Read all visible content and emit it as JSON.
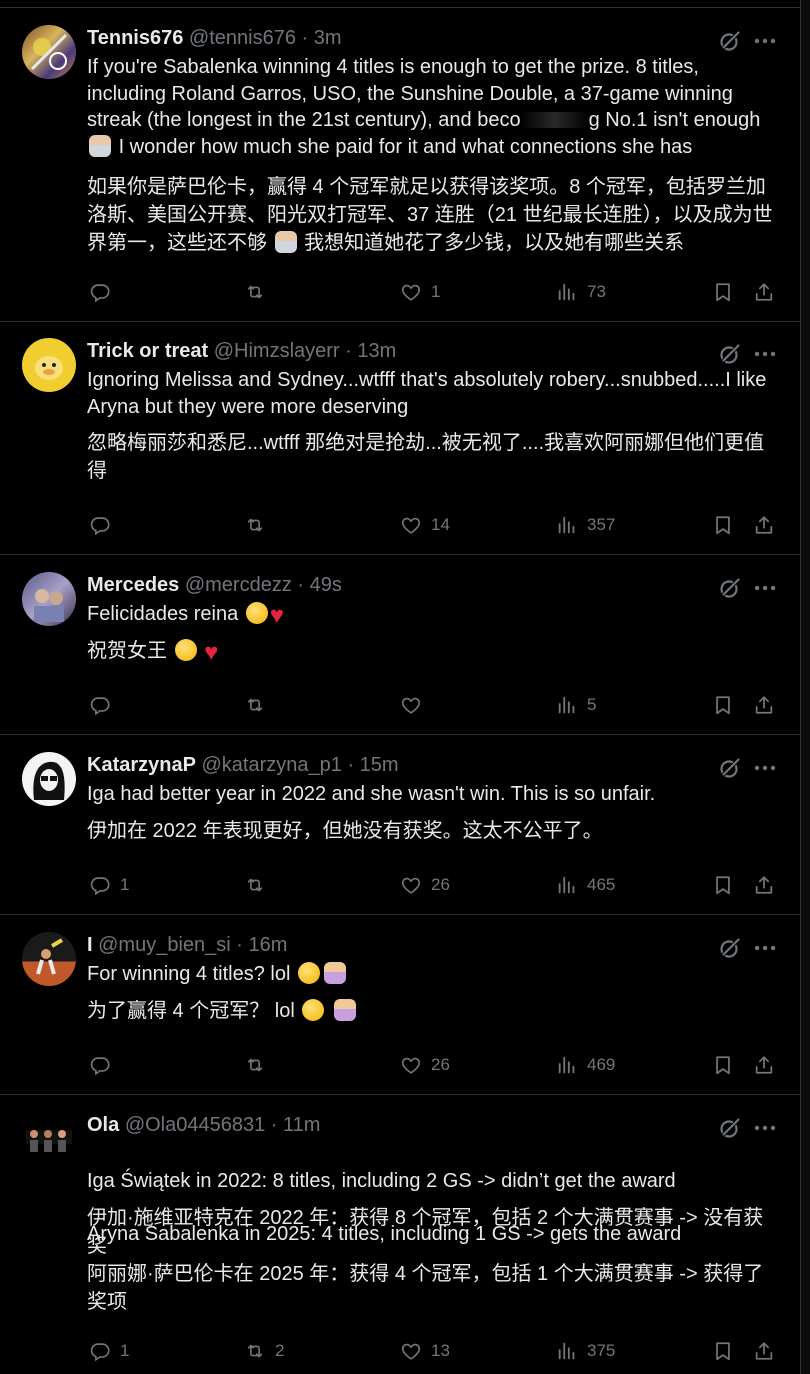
{
  "colors": {
    "background": "#000000",
    "text": "#e7e9ea",
    "muted": "#71767b",
    "border": "#2f3336",
    "heart": "#e5243b"
  },
  "icons": {
    "reply": "reply-icon",
    "retweet": "retweet-icon",
    "like": "like-icon",
    "views": "views-icon",
    "bookmark": "bookmark-icon",
    "share": "share-icon",
    "grok": "grok-icon",
    "more": "more-icon"
  },
  "tweets": [
    {
      "name": "Tennis676",
      "handle": "@tennis676",
      "time": "· 3m",
      "text_a": "If you're Sabalenka winning 4 titles is enough to get the prize. 8 titles, including Roland Garros, USO, the Sunshine Double, a 37-game winning streak (the longest in the 21st century), and beco",
      "text_b": "g No.1 isn't enough",
      "text_c": "I wonder how much she paid for it and what connections she has",
      "translation_a": "如果你是萨巴伦卡，赢得 4 个冠军就足以获得该奖项。8 个冠军，包括罗兰加洛斯、美国公开赛、阳光双打冠军、37 连胜（21 世纪最长连胜），以及成为世界第一，这些还不够",
      "translation_b": "我想知道她花了多少钱，以及她有哪些关系",
      "replies": "",
      "retweets": "",
      "likes": "1",
      "views": "73"
    },
    {
      "name": "Trick or treat",
      "handle": "@Himzslayerr",
      "time": "· 13m",
      "text": "Ignoring Melissa and Sydney...wtfff that's absolutely robery...snubbed.....I like Aryna but they were more deserving",
      "translation": "忽略梅丽莎和悉尼...wtfff 那绝对是抢劫...被无视了....我喜欢阿丽娜但他们更值得",
      "replies": "",
      "retweets": "",
      "likes": "14",
      "views": "357"
    },
    {
      "name": "Mercedes",
      "handle": "@mercdezz",
      "time": "· 49s",
      "text": "Felicidades reina",
      "translation": "祝贺女王",
      "replies": "",
      "retweets": "",
      "likes": "",
      "views": "5"
    },
    {
      "name": "KatarzynaP",
      "handle": "@katarzyna_p1",
      "time": "· 15m",
      "text": "Iga had better year in 2022 and she wasn't win. This is so unfair.",
      "translation": "伊加在 2022 年表现更好，但她没有获奖。这太不公平了。",
      "replies": "1",
      "retweets": "",
      "likes": "26",
      "views": "465"
    },
    {
      "name": "I",
      "handle": "@muy_bien_si",
      "time": "· 16m",
      "text": "For winning 4 titles? lol",
      "translation": "为了赢得 4 个冠军？ lol",
      "replies": "",
      "retweets": "",
      "likes": "26",
      "views": "469"
    },
    {
      "name": "Ola",
      "handle": "@Ola04456831",
      "time": "· 11m",
      "text_l1": "Iga Świątek in 2022: 8 titles, including 2 GS -> didn’t get the award",
      "text_l2": "Aryna Sabalenka in 2025: 4 titles, including 1 GS -> gets the award",
      "translation_l1": "伊加·施维亚特克在 2022 年：获得 8 个冠军，包括 2 个大满贯赛事 -> 没有获奖",
      "translation_l2": "阿丽娜·萨巴伦卡在 2025 年：获得 4 个冠军，包括 1 个大满贯赛事 -> 获得了奖项",
      "replies": "1",
      "retweets": "2",
      "likes": "13",
      "views": "375"
    }
  ]
}
